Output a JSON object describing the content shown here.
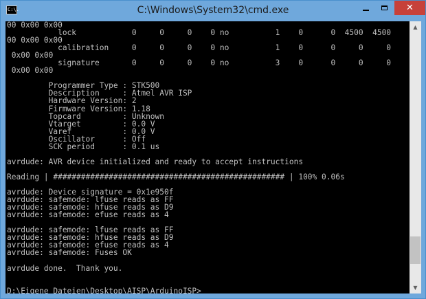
{
  "window": {
    "title": "C:\\Windows\\System32\\cmd.exe",
    "icon_label": "C:\\.",
    "close_glyph": "✕"
  },
  "console": {
    "lines": [
      "00 0x00 0x00",
      "           lock            0     0     0    0 no          1    0      0  4500  4500",
      "00 0x00 0x00",
      "           calibration     0     0     0    0 no          1    0      0     0     0",
      " 0x00 0x00",
      "           signature       0     0     0    0 no          3    0      0     0     0",
      " 0x00 0x00",
      "",
      "         Programmer Type : STK500",
      "         Description     : Atmel AVR ISP",
      "         Hardware Version: 2",
      "         Firmware Version: 1.18",
      "         Topcard         : Unknown",
      "         Vtarget         : 0.0 V",
      "         Varef           : 0.0 V",
      "         Oscillator      : Off",
      "         SCK period      : 0.1 us",
      "",
      "avrdude: AVR device initialized and ready to accept instructions",
      "",
      "Reading | ################################################## | 100% 0.06s",
      "",
      "avrdude: Device signature = 0x1e950f",
      "avrdude: safemode: lfuse reads as FF",
      "avrdude: safemode: hfuse reads as D9",
      "avrdude: safemode: efuse reads as 4",
      "",
      "avrdude: safemode: lfuse reads as FF",
      "avrdude: safemode: hfuse reads as D9",
      "avrdude: safemode: efuse reads as 4",
      "avrdude: safemode: Fuses OK",
      "",
      "avrdude done.  Thank you.",
      "",
      "",
      "D:\\Eigene Dateien\\Desktop\\AISP\\ArduinoISP>"
    ]
  },
  "scrollbar": {
    "up_glyph": "▲",
    "down_glyph": "▼",
    "position_fraction": 0.92
  }
}
